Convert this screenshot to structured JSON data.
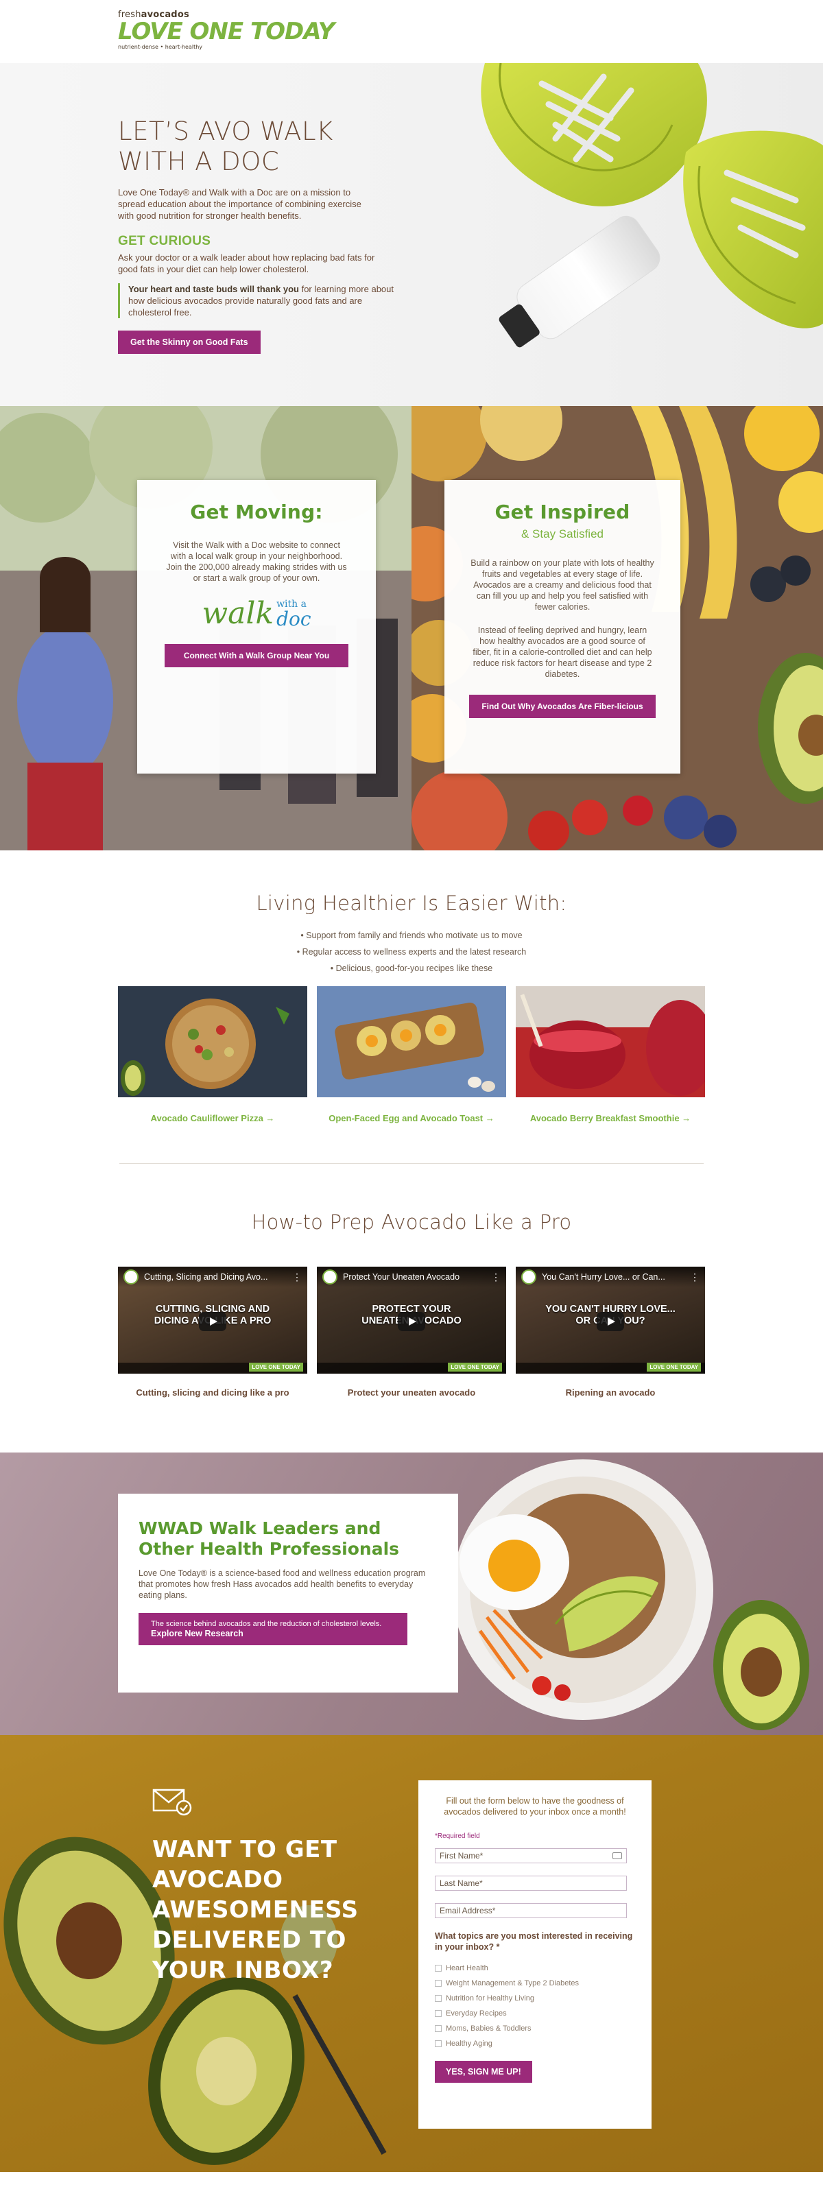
{
  "header": {
    "logo_fresh_prefix": "fresh",
    "logo_fresh_bold": "avocados",
    "logo_main": "LOVE ONE TODAY",
    "logo_tagline": "nutrient-dense • heart-healthy"
  },
  "hero": {
    "title_line1": "LET’S AVO WALK",
    "title_line2": "WITH A DOC",
    "intro": "Love One Today® and Walk with a Doc are on a mission to spread education about the importance of combining exercise with good nutrition for stronger health benefits.",
    "subheading": "GET CURIOUS",
    "sub_body": "Ask your doctor or a walk leader about how replacing bad fats for good fats in your diet can help lower cholesterol.",
    "quote_bold": "Your heart and taste buds will thank you",
    "quote_rest": " for learning more about how delicious avocados provide naturally good fats and are cholesterol free.",
    "button": "Get the Skinny on Good Fats"
  },
  "moving": {
    "title": "Get Moving:",
    "body": "Visit the Walk with a Doc website to connect with a local walk group in your neighborhood. Join the 200,000 already making strides with us or start a walk group of your own.",
    "logo_word": "walk",
    "logo_small": "with a",
    "logo_big": "doc",
    "button": "Connect With a Walk Group Near You"
  },
  "inspired": {
    "title": "Get Inspired",
    "subtitle": "& Stay Satisfied",
    "body1": "Build a rainbow on your plate with lots of healthy fruits and vegetables at every stage of life. Avocados are a creamy and delicious food that can fill you up and help you feel satisfied with fewer calories.",
    "body2": "Instead of feeling deprived and hungry, learn how healthy avocados are a good source of fiber, fit in a calorie-controlled diet and can help reduce risk factors for heart disease and type 2 diabetes.",
    "button": "Find Out Why Avocados Are Fiber-licious"
  },
  "living": {
    "title": "Living Healthier Is Easier With:",
    "bullets": [
      "• Support from family and friends who motivate us to move",
      "• Regular access to wellness experts and the latest research",
      "• Delicious, good-for-you recipes like these"
    ],
    "recipes": [
      {
        "label": "Avocado Cauliflower Pizza →"
      },
      {
        "label": "Open-Faced Egg and Avocado Toast →"
      },
      {
        "label": "Avocado Berry Breakfast Smoothie →"
      }
    ]
  },
  "howto": {
    "title": "How-to Prep Avocado Like a Pro",
    "videos": [
      {
        "title": "Cutting, Slicing and Dicing Avo...",
        "overlay_line1": "CUTTING, SLICING AND",
        "overlay_line2": "DICING AVO        LIKE A PRO",
        "brand": "LOVE ONE TODAY",
        "caption": "Cutting, slicing and dicing like a pro"
      },
      {
        "title": "Protect Your Uneaten Avocado",
        "overlay_line1": "PROTECT YOUR",
        "overlay_line2": "UNEATEN AVOCADO",
        "brand": "LOVE ONE TODAY",
        "caption": "Protect your uneaten avocado"
      },
      {
        "title": "You Can't Hurry Love... or Can...",
        "overlay_line1": "YOU CAN'T HURRY LOVE...",
        "overlay_line2": "OR CAN YOU?",
        "brand": "LOVE ONE TODAY",
        "caption": "Ripening an avocado"
      }
    ]
  },
  "wwad": {
    "title": "WWAD Walk Leaders and Other Health Professionals",
    "body": "Love One Today® is a science-based food and wellness education program that promotes how fresh Hass avocados add health benefits to everyday eating plans.",
    "button_line1": "The science behind avocados and the reduction of cholesterol levels.",
    "button_line2": "Explore New Research"
  },
  "newsletter": {
    "heading": "WANT TO GET AVOCADO AWESOMENESS DELIVERED TO YOUR INBOX?",
    "intro": "Fill out the form below to have the goodness of avocados delivered to your inbox once a month!",
    "required": "*Required field",
    "first_name_placeholder": "First Name*",
    "last_name_placeholder": "Last Name*",
    "email_placeholder": "Email Address*",
    "topics_question": "What topics are you most interested in receiving in your inbox? *",
    "topics": [
      "Heart Health",
      "Weight Management & Type 2 Diabetes",
      "Nutrition for Healthy Living",
      "Everyday Recipes",
      "Moms, Babies & Toddlers",
      "Healthy Aging"
    ],
    "submit": "YES, SIGN ME UP!"
  }
}
